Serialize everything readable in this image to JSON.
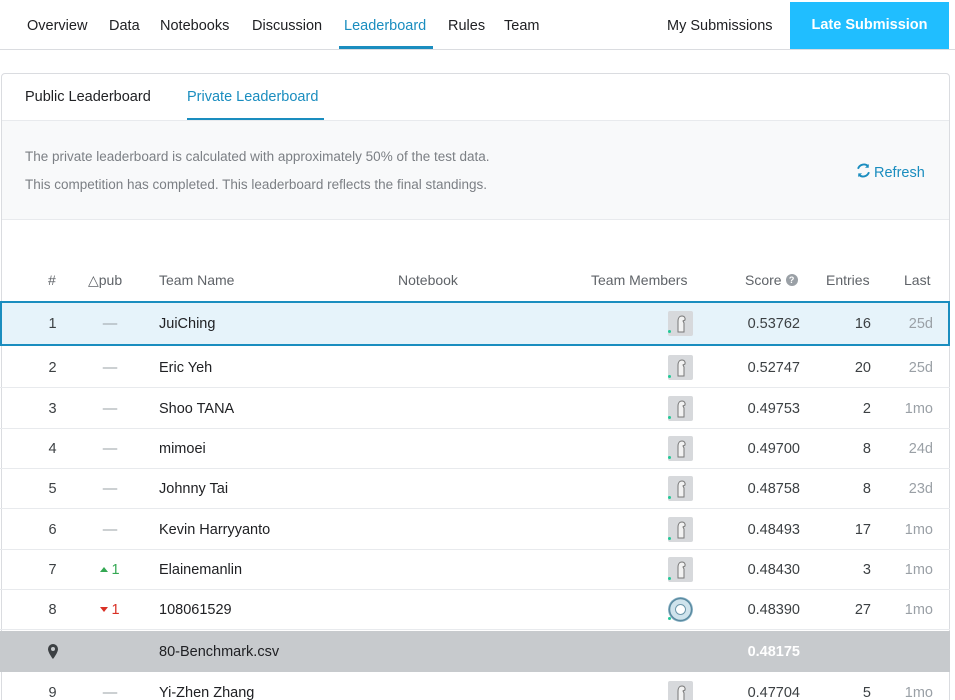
{
  "nav": {
    "tabs": [
      {
        "label": "Overview"
      },
      {
        "label": "Data"
      },
      {
        "label": "Notebooks"
      },
      {
        "label": "Discussion"
      },
      {
        "label": "Leaderboard",
        "active": true
      },
      {
        "label": "Rules"
      },
      {
        "label": "Team"
      }
    ],
    "my_submissions": "My Submissions",
    "late_submission": "Late Submission"
  },
  "leaderboard": {
    "subtabs": [
      {
        "label": "Public Leaderboard"
      },
      {
        "label": "Private Leaderboard",
        "active": true
      }
    ],
    "info_line1": "The private leaderboard is calculated with approximately 50% of the test data.",
    "info_line2": "This competition has completed. This leaderboard reflects the final standings.",
    "refresh_label": "Refresh",
    "columns": {
      "rank": "#",
      "delta": "△pub",
      "team_name": "Team Name",
      "notebook": "Notebook",
      "team_members": "Team Members",
      "score": "Score",
      "entries": "Entries",
      "last": "Last"
    },
    "rows": [
      {
        "rank": "1",
        "delta": "—",
        "team": "JuiChing",
        "score": "0.53762",
        "entries": "16",
        "last": "25d",
        "highlight": true
      },
      {
        "rank": "2",
        "delta": "—",
        "team": "Eric Yeh",
        "score": "0.52747",
        "entries": "20",
        "last": "25d"
      },
      {
        "rank": "3",
        "delta": "—",
        "team": "Shoo TANA",
        "score": "0.49753",
        "entries": "2",
        "last": "1mo"
      },
      {
        "rank": "4",
        "delta": "—",
        "team": "mimoei",
        "score": "0.49700",
        "entries": "8",
        "last": "24d"
      },
      {
        "rank": "5",
        "delta": "—",
        "team": "Johnny Tai",
        "score": "0.48758",
        "entries": "8",
        "last": "23d"
      },
      {
        "rank": "6",
        "delta": "—",
        "team": "Kevin Harryyanto",
        "score": "0.48493",
        "entries": "17",
        "last": "1mo"
      },
      {
        "rank": "7",
        "delta": "1",
        "delta_dir": "up",
        "team": "Elainemanlin",
        "score": "0.48430",
        "entries": "3",
        "last": "1mo"
      },
      {
        "rank": "8",
        "delta": "1",
        "delta_dir": "down",
        "team": "108061529",
        "score": "0.48390",
        "entries": "27",
        "last": "1mo",
        "avatar": "round"
      },
      {
        "rank": "",
        "team": "80-Benchmark.csv",
        "score": "0.48175",
        "benchmark": true
      },
      {
        "rank": "9",
        "delta": "—",
        "team": "Yi-Zhen Zhang",
        "score": "0.47704",
        "entries": "5",
        "last": "1mo"
      }
    ]
  }
}
